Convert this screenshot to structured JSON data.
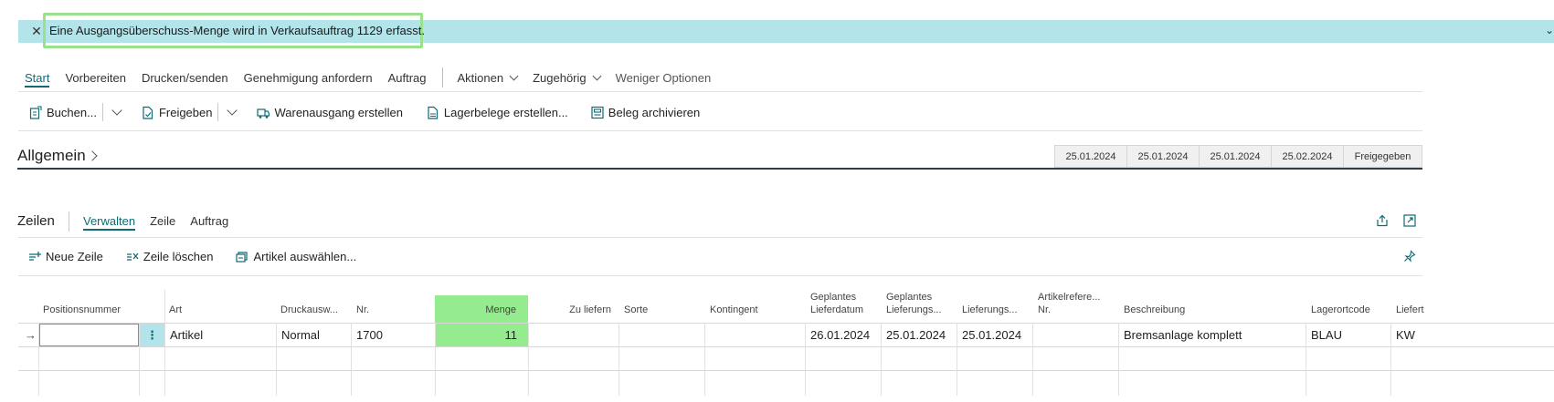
{
  "notification": {
    "message": "Eine Ausgangsüberschuss-Menge wird in Verkaufsauftrag 1129 erfasst.",
    "close_icon": "close-icon",
    "expand_icon": "chevron-down-icon"
  },
  "action_tabs": [
    {
      "label": "Start",
      "active": true
    },
    {
      "label": "Vorbereiten"
    },
    {
      "label": "Drucken/senden"
    },
    {
      "label": "Genehmigung anfordern"
    },
    {
      "label": "Auftrag"
    },
    {
      "label": "Aktionen",
      "dropdown": true
    },
    {
      "label": "Zugehörig",
      "dropdown": true
    },
    {
      "label": "Weniger Optionen"
    }
  ],
  "toolbar": {
    "buchen": "Buchen...",
    "freigeben": "Freigeben",
    "warenausgang": "Warenausgang erstellen",
    "lagerbelege": "Lagerbelege erstellen...",
    "beleg_archivieren": "Beleg archivieren"
  },
  "general": {
    "title": "Allgemein",
    "summary": [
      "25.01.2024",
      "25.01.2024",
      "25.01.2024",
      "25.02.2024",
      "Freigegeben"
    ]
  },
  "lines": {
    "title": "Zeilen",
    "tabs": [
      "Verwalten",
      "Zeile",
      "Auftrag"
    ],
    "toolbar": {
      "neue_zeile": "Neue Zeile",
      "zeile_loeschen": "Zeile löschen",
      "artikel_auswaehlen": "Artikel auswählen..."
    },
    "columns": {
      "positionsnummer": "Positionsnummer",
      "art": "Art",
      "druckauswahl": "Druckausw...",
      "nr": "Nr.",
      "menge": "Menge",
      "zu_liefern": "Zu liefern",
      "sorte": "Sorte",
      "kontingent": "Kontingent",
      "geplantes_lieferdatum_1": "Geplantes",
      "geplantes_lieferdatum_2": "Lieferdatum",
      "geplantes_lieferungs_1": "Geplantes",
      "geplantes_lieferungs_2": "Lieferungs...",
      "lieferungs": "Lieferungs...",
      "artikelreferenz_1": "Artikelrefere...",
      "artikelreferenz_2": "Nr.",
      "beschreibung": "Beschreibung",
      "lagerortcode": "Lagerortcode",
      "lieferung": "Liefert"
    },
    "row": {
      "art": "Artikel",
      "druckauswahl": "Normal",
      "nr": "1700",
      "menge": "11",
      "geplantes_lieferdatum": "26.01.2024",
      "geplantes_lieferungsdatum": "25.01.2024",
      "lieferungsdatum": "25.01.2024",
      "beschreibung": "Bremsanlage komplett",
      "lagerortcode": "BLAU",
      "lieferung": "KW"
    }
  },
  "colors": {
    "accent": "#0f6a74",
    "notification_bg": "#b2e4ea",
    "highlight": "#95ec8e"
  }
}
